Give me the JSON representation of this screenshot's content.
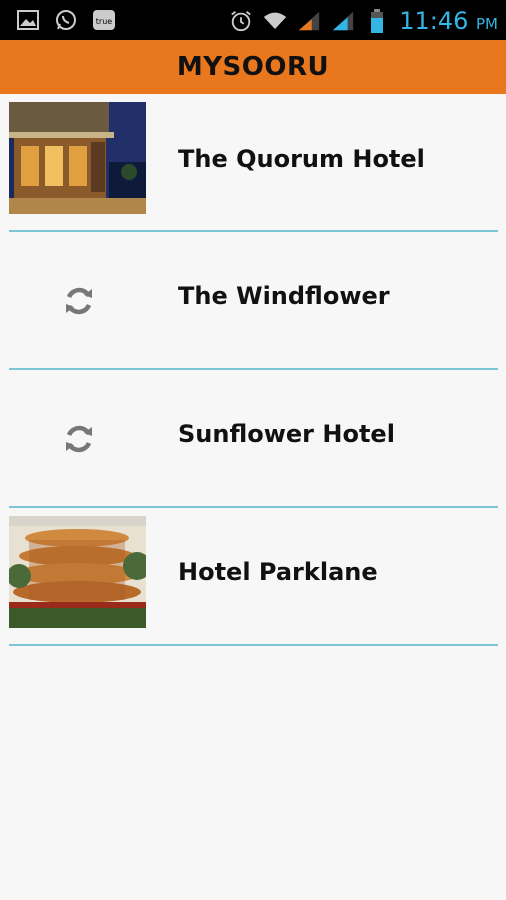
{
  "status_bar": {
    "time": "11:46",
    "ampm": "PM",
    "left_icons": [
      "gallery-icon",
      "whatsapp-icon",
      "truecaller-icon"
    ],
    "right_icons": [
      "alarm-icon",
      "wifi-icon",
      "signal-icon",
      "signal-icon",
      "battery-icon"
    ]
  },
  "app_bar": {
    "title": "MYSOORU"
  },
  "hotels": [
    {
      "name": "The Quorum Hotel",
      "image": "photo",
      "icon": "hotel-photo"
    },
    {
      "name": "The Windflower",
      "image": "loading",
      "icon": "refresh-icon"
    },
    {
      "name": "Sunflower Hotel",
      "image": "loading",
      "icon": "refresh-icon"
    },
    {
      "name": "Hotel Parklane",
      "image": "photo",
      "icon": "hotel-photo"
    }
  ],
  "colors": {
    "app_bar": "#e8771e",
    "divider": "#7ec4d4",
    "status_accent": "#33b5e5",
    "background": "#f7f7f7"
  }
}
